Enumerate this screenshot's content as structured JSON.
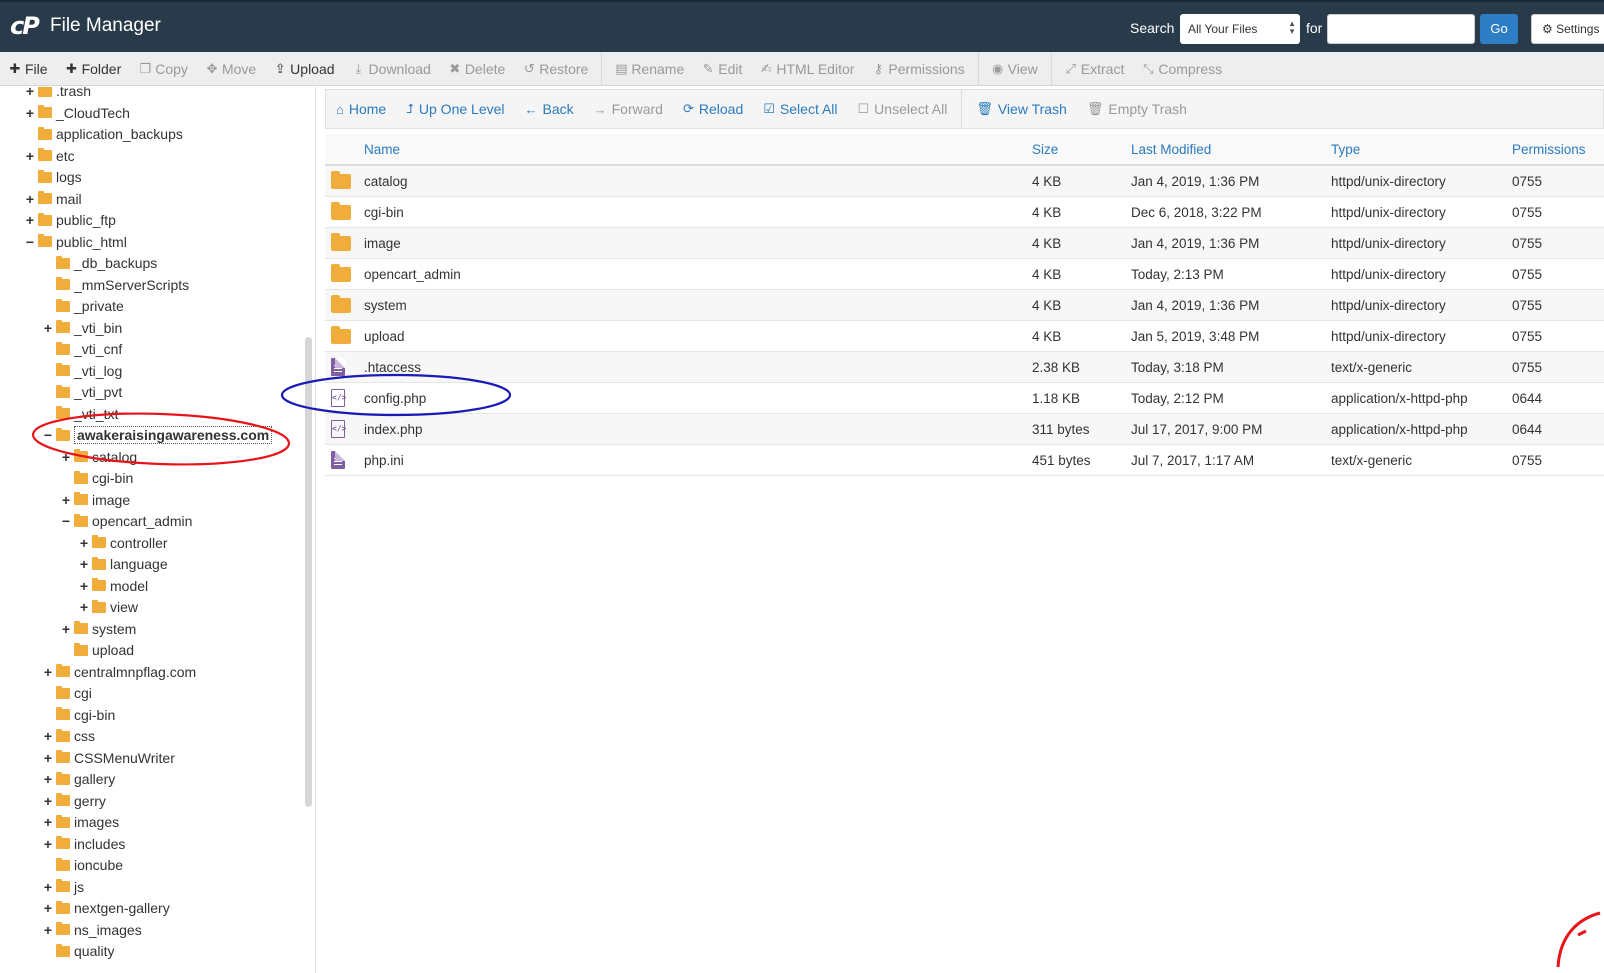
{
  "header": {
    "logo": "cP",
    "title": "File Manager",
    "search_label": "Search",
    "search_scope": "All Your Files",
    "for_label": "for",
    "search_value": "",
    "go_label": "Go",
    "settings_label": "Settings"
  },
  "toolbar": {
    "items": [
      {
        "label": "File",
        "icon": "plus-icon",
        "glyph": "✚",
        "active": true
      },
      {
        "label": "Folder",
        "icon": "plus-icon",
        "glyph": "✚",
        "active": true
      },
      {
        "label": "Copy",
        "icon": "copy-icon",
        "glyph": "❐",
        "active": false
      },
      {
        "label": "Move",
        "icon": "move-icon",
        "glyph": "✥",
        "active": false
      },
      {
        "label": "Upload",
        "icon": "upload-icon",
        "glyph": "⇪",
        "active": true
      },
      {
        "label": "Download",
        "icon": "download-icon",
        "glyph": "⤓",
        "active": false
      },
      {
        "label": "Delete",
        "icon": "delete-icon",
        "glyph": "✖",
        "active": false
      },
      {
        "label": "Restore",
        "icon": "restore-icon",
        "glyph": "↺",
        "active": false
      },
      {
        "label": "Rename",
        "icon": "rename-icon",
        "glyph": "▤",
        "active": false
      },
      {
        "label": "Edit",
        "icon": "pencil-icon",
        "glyph": "✎",
        "active": false
      },
      {
        "label": "HTML Editor",
        "icon": "html-editor-icon",
        "glyph": "✍",
        "active": false
      },
      {
        "label": "Permissions",
        "icon": "key-icon",
        "glyph": "⚷",
        "active": false
      },
      {
        "label": "View",
        "icon": "eye-icon",
        "glyph": "◉",
        "active": false
      },
      {
        "label": "Extract",
        "icon": "extract-icon",
        "glyph": "⤢",
        "active": false
      },
      {
        "label": "Compress",
        "icon": "compress-icon",
        "glyph": "⤡",
        "active": false
      }
    ]
  },
  "nav": {
    "items": [
      {
        "label": "Home",
        "icon": "home-icon",
        "glyph": "⌂",
        "disabled": false
      },
      {
        "label": "Up One Level",
        "icon": "level-up-icon",
        "glyph": "⮥",
        "disabled": false
      },
      {
        "label": "Back",
        "icon": "back-arrow-icon",
        "glyph": "←",
        "disabled": false
      },
      {
        "label": "Forward",
        "icon": "forward-arrow-icon",
        "glyph": "→",
        "disabled": true
      },
      {
        "label": "Reload",
        "icon": "reload-icon",
        "glyph": "⟳",
        "disabled": false
      },
      {
        "label": "Select All",
        "icon": "checkbox-checked-icon",
        "glyph": "☑",
        "disabled": false
      },
      {
        "label": "Unselect All",
        "icon": "checkbox-empty-icon",
        "glyph": "☐",
        "disabled": true
      },
      {
        "label": "View Trash",
        "icon": "trash-icon",
        "glyph": "🗑",
        "disabled": false
      },
      {
        "label": "Empty Trash",
        "icon": "trash-icon",
        "glyph": "🗑",
        "disabled": true
      }
    ]
  },
  "table": {
    "columns": {
      "name": "Name",
      "size": "Size",
      "modified": "Last Modified",
      "type": "Type",
      "perms": "Permissions"
    },
    "rows": [
      {
        "icon": "folder",
        "name": "catalog",
        "size": "4 KB",
        "modified": "Jan 4, 2019, 1:36 PM",
        "type": "httpd/unix-directory",
        "perms": "0755"
      },
      {
        "icon": "folder",
        "name": "cgi-bin",
        "size": "4 KB",
        "modified": "Dec 6, 2018, 3:22 PM",
        "type": "httpd/unix-directory",
        "perms": "0755"
      },
      {
        "icon": "folder",
        "name": "image",
        "size": "4 KB",
        "modified": "Jan 4, 2019, 1:36 PM",
        "type": "httpd/unix-directory",
        "perms": "0755"
      },
      {
        "icon": "folder",
        "name": "opencart_admin",
        "size": "4 KB",
        "modified": "Today, 2:13 PM",
        "type": "httpd/unix-directory",
        "perms": "0755"
      },
      {
        "icon": "folder",
        "name": "system",
        "size": "4 KB",
        "modified": "Jan 4, 2019, 1:36 PM",
        "type": "httpd/unix-directory",
        "perms": "0755"
      },
      {
        "icon": "folder",
        "name": "upload",
        "size": "4 KB",
        "modified": "Jan 5, 2019, 3:48 PM",
        "type": "httpd/unix-directory",
        "perms": "0755"
      },
      {
        "icon": "text",
        "name": ".htaccess",
        "size": "2.38 KB",
        "modified": "Today, 3:18 PM",
        "type": "text/x-generic",
        "perms": "0755"
      },
      {
        "icon": "code",
        "name": "config.php",
        "size": "1.18 KB",
        "modified": "Today, 2:12 PM",
        "type": "application/x-httpd-php",
        "perms": "0644"
      },
      {
        "icon": "code",
        "name": "index.php",
        "size": "311 bytes",
        "modified": "Jul 17, 2017, 9:00 PM",
        "type": "application/x-httpd-php",
        "perms": "0644"
      },
      {
        "icon": "text",
        "name": "php.ini",
        "size": "451 bytes",
        "modified": "Jul 7, 2017, 1:17 AM",
        "type": "text/x-generic",
        "perms": "0755"
      }
    ]
  },
  "tree": {
    "items": [
      {
        "label": ".trash",
        "depth": 0,
        "toggle": "+"
      },
      {
        "label": "_CloudTech",
        "depth": 0,
        "toggle": "+"
      },
      {
        "label": "application_backups",
        "depth": 0,
        "toggle": ""
      },
      {
        "label": "etc",
        "depth": 0,
        "toggle": "+"
      },
      {
        "label": "logs",
        "depth": 0,
        "toggle": ""
      },
      {
        "label": "mail",
        "depth": 0,
        "toggle": "+"
      },
      {
        "label": "public_ftp",
        "depth": 0,
        "toggle": "+"
      },
      {
        "label": "public_html",
        "depth": 0,
        "toggle": "−"
      },
      {
        "label": "_db_backups",
        "depth": 1,
        "toggle": ""
      },
      {
        "label": "_mmServerScripts",
        "depth": 1,
        "toggle": ""
      },
      {
        "label": "_private",
        "depth": 1,
        "toggle": ""
      },
      {
        "label": "_vti_bin",
        "depth": 1,
        "toggle": "+"
      },
      {
        "label": "_vti_cnf",
        "depth": 1,
        "toggle": ""
      },
      {
        "label": "_vti_log",
        "depth": 1,
        "toggle": ""
      },
      {
        "label": "_vti_pvt",
        "depth": 1,
        "toggle": ""
      },
      {
        "label": "_vti_txt",
        "depth": 1,
        "toggle": ""
      },
      {
        "label": "awakeraisingawareness.com",
        "depth": 1,
        "toggle": "−",
        "selected": true
      },
      {
        "label": "catalog",
        "depth": 2,
        "toggle": "+"
      },
      {
        "label": "cgi-bin",
        "depth": 2,
        "toggle": ""
      },
      {
        "label": "image",
        "depth": 2,
        "toggle": "+"
      },
      {
        "label": "opencart_admin",
        "depth": 2,
        "toggle": "−"
      },
      {
        "label": "controller",
        "depth": 3,
        "toggle": "+"
      },
      {
        "label": "language",
        "depth": 3,
        "toggle": "+"
      },
      {
        "label": "model",
        "depth": 3,
        "toggle": "+"
      },
      {
        "label": "view",
        "depth": 3,
        "toggle": "+"
      },
      {
        "label": "system",
        "depth": 2,
        "toggle": "+"
      },
      {
        "label": "upload",
        "depth": 2,
        "toggle": ""
      },
      {
        "label": "centralmnpflag.com",
        "depth": 1,
        "toggle": "+"
      },
      {
        "label": "cgi",
        "depth": 1,
        "toggle": ""
      },
      {
        "label": "cgi-bin",
        "depth": 1,
        "toggle": ""
      },
      {
        "label": "css",
        "depth": 1,
        "toggle": "+"
      },
      {
        "label": "CSSMenuWriter",
        "depth": 1,
        "toggle": "+"
      },
      {
        "label": "gallery",
        "depth": 1,
        "toggle": "+"
      },
      {
        "label": "gerry",
        "depth": 1,
        "toggle": "+"
      },
      {
        "label": "images",
        "depth": 1,
        "toggle": "+"
      },
      {
        "label": "includes",
        "depth": 1,
        "toggle": "+"
      },
      {
        "label": "ioncube",
        "depth": 1,
        "toggle": ""
      },
      {
        "label": "js",
        "depth": 1,
        "toggle": "+"
      },
      {
        "label": "nextgen-gallery",
        "depth": 1,
        "toggle": "+"
      },
      {
        "label": "ns_images",
        "depth": 1,
        "toggle": "+"
      },
      {
        "label": "quality",
        "depth": 1,
        "toggle": ""
      }
    ]
  },
  "colors": {
    "header_bg": "#293a4a",
    "link_blue": "#2a7bbf",
    "folder_orange": "#f0ad3c",
    "file_purple": "#7f5fa1",
    "annotation_red": "#e8141c",
    "annotation_blue": "#1a1ab8"
  }
}
